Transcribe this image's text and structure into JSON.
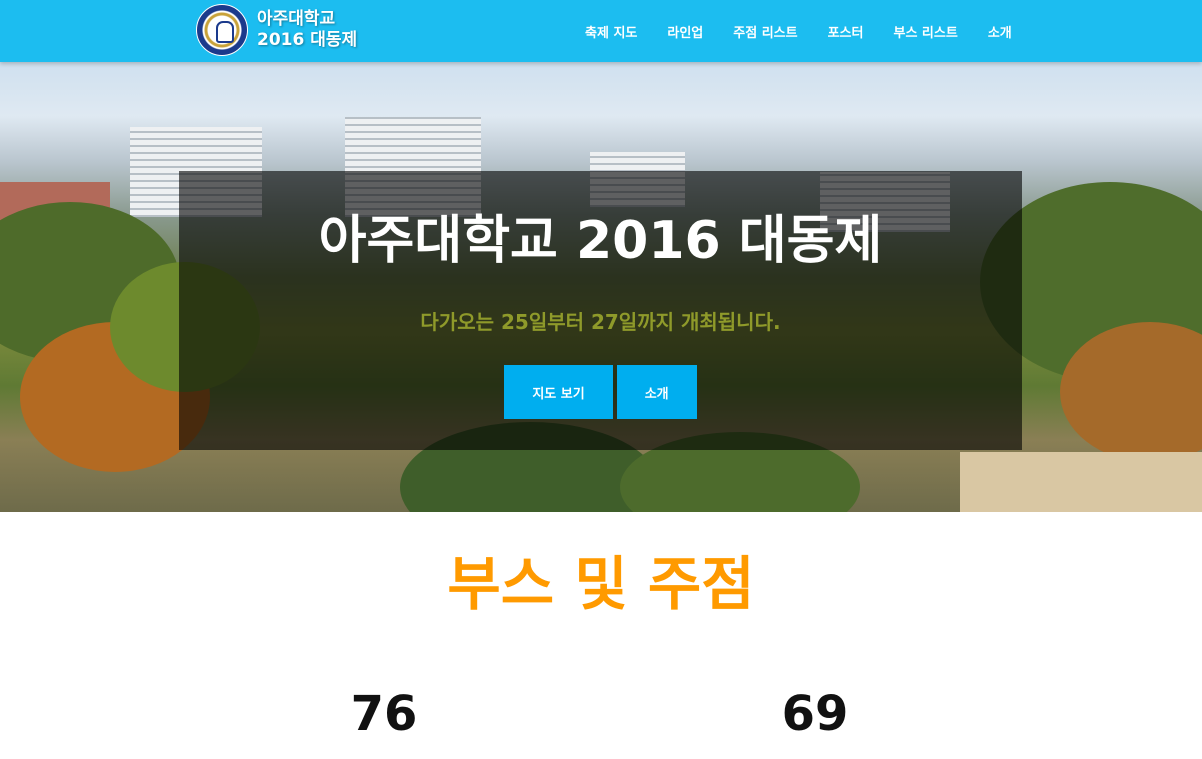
{
  "brand": {
    "line1": "아주대학교",
    "line2": "2016 대동제"
  },
  "nav": {
    "items": [
      {
        "label": "축제 지도"
      },
      {
        "label": "라인업"
      },
      {
        "label": "주점 리스트"
      },
      {
        "label": "포스터"
      },
      {
        "label": "부스 리스트"
      },
      {
        "label": "소개"
      }
    ]
  },
  "hero": {
    "title": "아주대학교 2016 대동제",
    "subtitle": "다가오는 25일부터 27일까지 개최됩니다.",
    "buttons": [
      {
        "label": "지도 보기"
      },
      {
        "label": "소개"
      }
    ]
  },
  "section": {
    "title": "부스 및 주점",
    "stats": [
      {
        "value": "76"
      },
      {
        "value": "69"
      }
    ]
  },
  "colors": {
    "navbar": "#1cbdf0",
    "button": "#00aeef",
    "section_title": "#ff9a00",
    "subtitle": "#8f9a2a"
  }
}
